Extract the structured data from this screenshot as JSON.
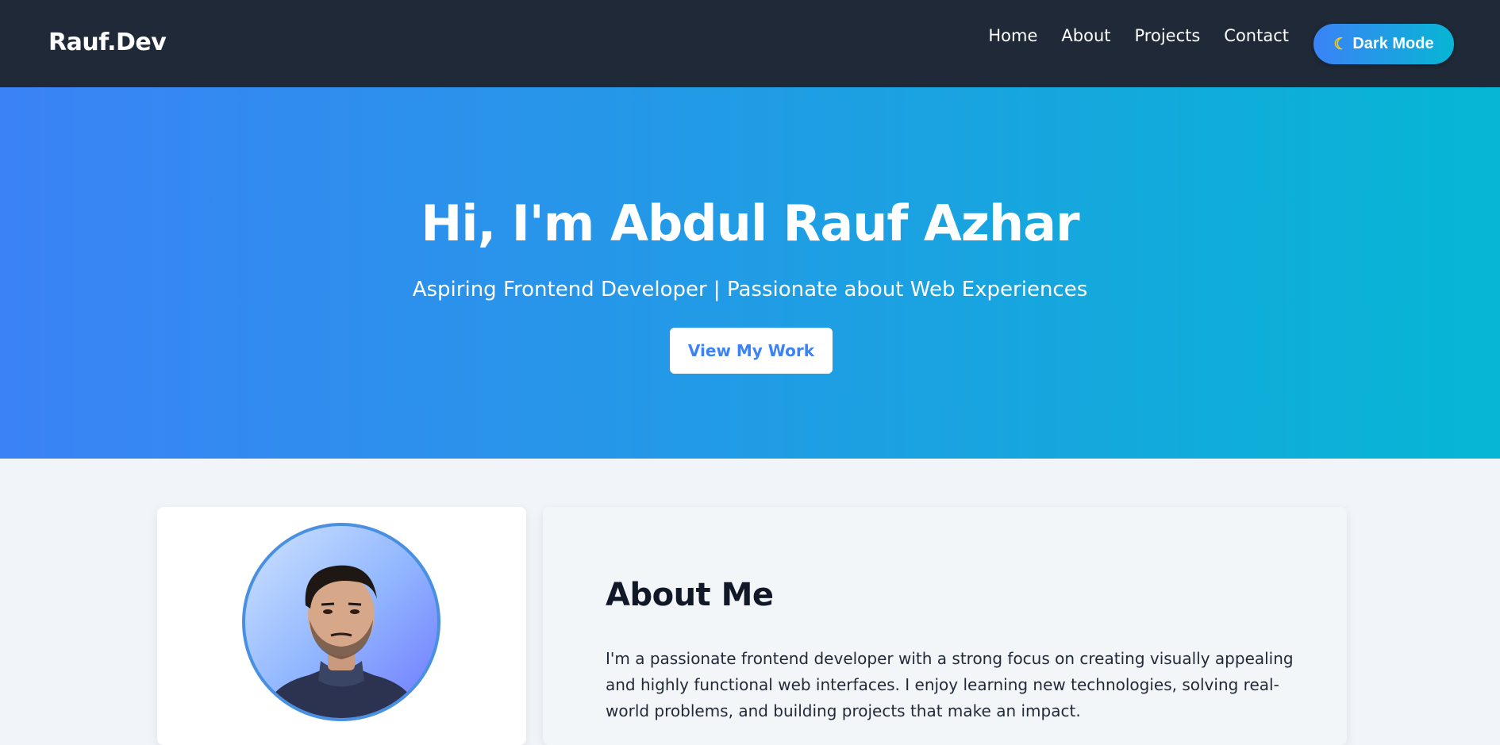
{
  "navbar": {
    "brand": "Rauf.Dev",
    "links": [
      "Home",
      "About",
      "Projects",
      "Contact"
    ],
    "theme_toggle": {
      "icon": "moon-icon",
      "label": "Dark Mode"
    }
  },
  "hero": {
    "title": "Hi, I'm Abdul Rauf Azhar",
    "subtitle": "Aspiring Frontend Developer | Passionate about Web Experiences",
    "cta_label": "View My Work"
  },
  "about": {
    "title": "About Me",
    "text": "I'm a passionate frontend developer with a strong focus on creating visually appealing and highly functional web interfaces. I enjoy learning new technologies, solving real-world problems, and building projects that make an impact."
  },
  "colors": {
    "navbar_bg": "#1f2937",
    "accent_start": "#3b82f6",
    "accent_end": "#06b6d4",
    "page_bg": "#f1f5f9",
    "avatar_border": "#4a90e2"
  }
}
